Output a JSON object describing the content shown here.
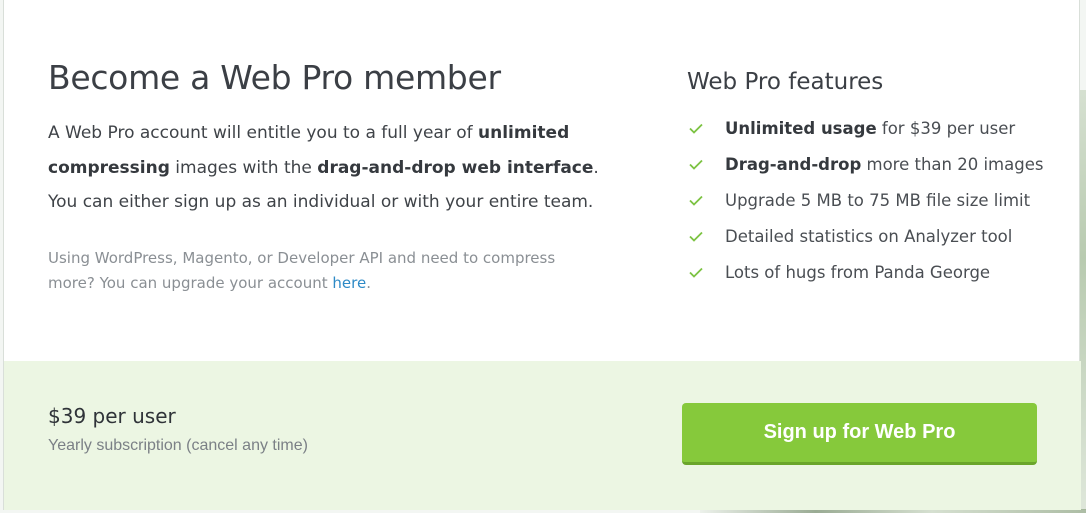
{
  "modal": {
    "title": "Become a Web Pro member",
    "intro": {
      "p1": "A Web Pro account will entitle you to a full year of ",
      "b1": "unlimited compressing",
      "p2": " images with the ",
      "b2": "drag-and-drop web interface",
      "p3": ". You can either sign up as an individual or with your entire team."
    },
    "upgrade_note": {
      "text": "Using WordPress, Magento, or Developer API and need to compress more? You can upgrade your account ",
      "link": "here",
      "suffix": "."
    }
  },
  "features": {
    "title": "Web Pro features",
    "check_icon": "checkmark-icon",
    "check_color": "#7cc242",
    "items": [
      {
        "bold": "Unlimited usage",
        "text": " for $39 per user"
      },
      {
        "bold": "Drag-and-drop",
        "text": " more than 20 images"
      },
      {
        "bold": "",
        "text": "Upgrade 5 MB to 75 MB file size limit"
      },
      {
        "bold": "",
        "text": "Detailed statistics on Analyzer tool"
      },
      {
        "bold": "",
        "text": "Lots of hugs from Panda George"
      }
    ]
  },
  "footer": {
    "price": "$39 per user",
    "price_sub": "Yearly subscription (cancel any time)",
    "signup_label": "Sign up for Web Pro",
    "accent_color": "#86c93b",
    "background_color": "#ecf6e3"
  }
}
